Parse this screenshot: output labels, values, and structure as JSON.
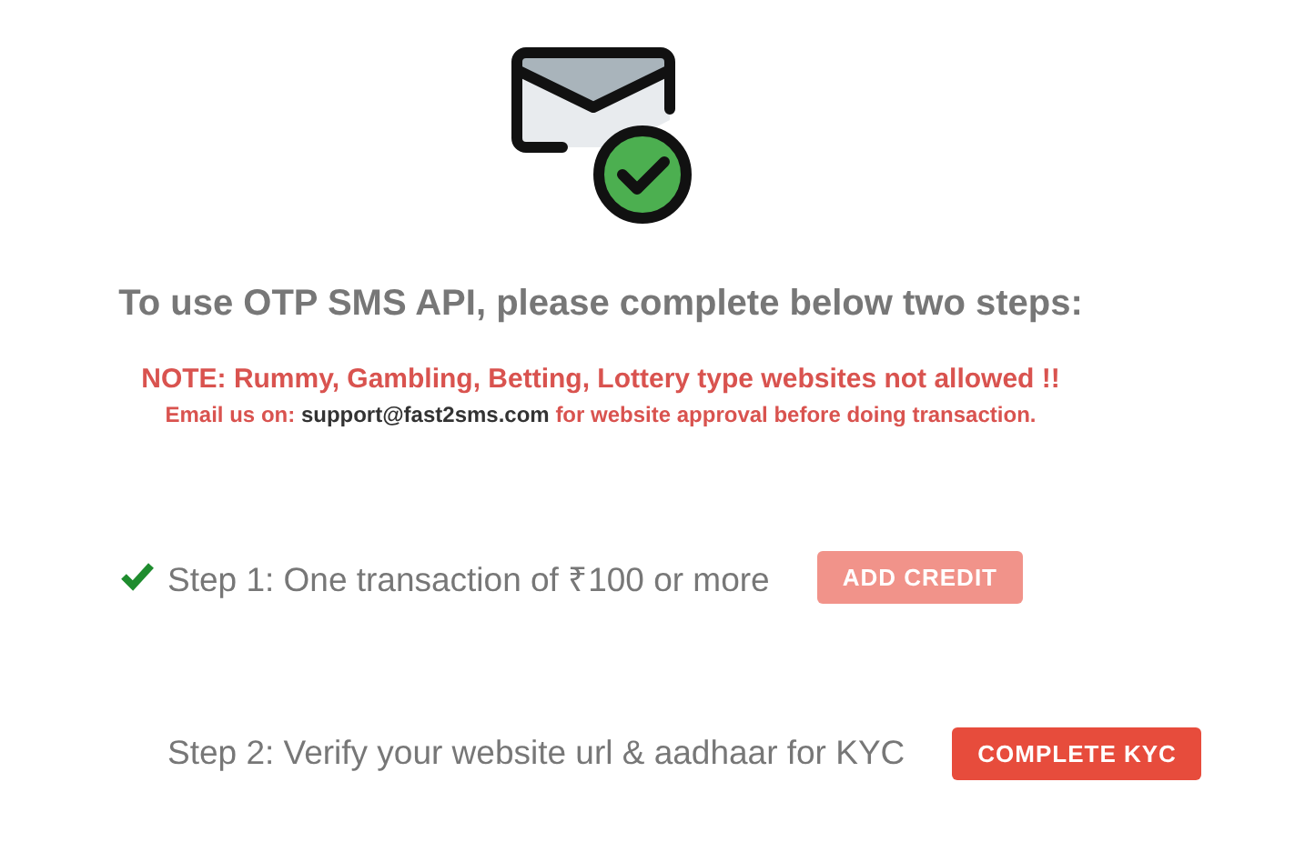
{
  "heading": "To use OTP SMS API, please complete below two steps:",
  "note": "NOTE: Rummy, Gambling, Betting, Lottery type websites not allowed !!",
  "email_line": {
    "prefix": "Email us on:",
    "email": "support@fast2sms.com",
    "suffix": "for website approval before doing transaction."
  },
  "steps": [
    {
      "label": "Step 1: One transaction of ₹100 or more",
      "done": true,
      "button": {
        "label": "ADD CREDIT",
        "disabled": true
      }
    },
    {
      "label": "Step 2: Verify your website url & aadhaar for KYC",
      "done": false,
      "button": {
        "label": "COMPLETE KYC",
        "disabled": false
      }
    }
  ]
}
